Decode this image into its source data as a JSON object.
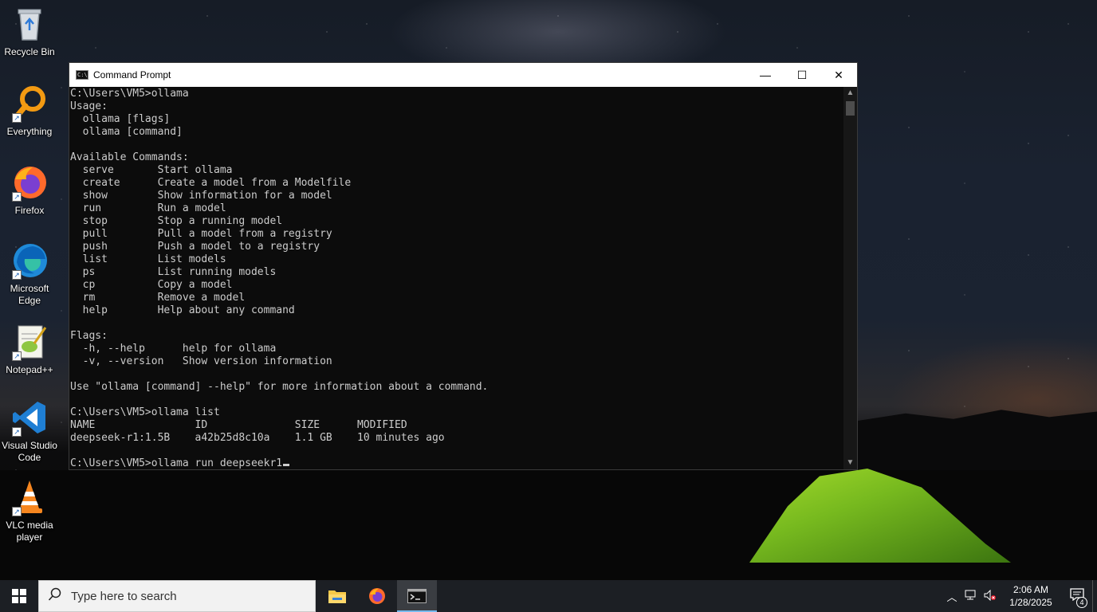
{
  "desktop": {
    "icons": [
      {
        "label": "Recycle Bin",
        "icon": "recycle-bin-icon"
      },
      {
        "label": "Everything",
        "icon": "everything-search-icon"
      },
      {
        "label": "Firefox",
        "icon": "firefox-icon"
      },
      {
        "label": "Microsoft Edge",
        "icon": "edge-icon"
      },
      {
        "label": "Notepad++",
        "icon": "notepadpp-icon"
      },
      {
        "label": "Visual Studio Code",
        "icon": "vscode-icon"
      },
      {
        "label": "VLC media player",
        "icon": "vlc-icon"
      }
    ]
  },
  "window": {
    "title": "Command Prompt",
    "minimize": "—",
    "maximize": "☐",
    "close": "✕"
  },
  "console": {
    "lines": [
      "C:\\Users\\VM5>ollama",
      "Usage:",
      "  ollama [flags]",
      "  ollama [command]",
      "",
      "Available Commands:",
      "  serve       Start ollama",
      "  create      Create a model from a Modelfile",
      "  show        Show information for a model",
      "  run         Run a model",
      "  stop        Stop a running model",
      "  pull        Pull a model from a registry",
      "  push        Push a model to a registry",
      "  list        List models",
      "  ps          List running models",
      "  cp          Copy a model",
      "  rm          Remove a model",
      "  help        Help about any command",
      "",
      "Flags:",
      "  -h, --help      help for ollama",
      "  -v, --version   Show version information",
      "",
      "Use \"ollama [command] --help\" for more information about a command.",
      "",
      "C:\\Users\\VM5>ollama list",
      "NAME                ID              SIZE      MODIFIED",
      "deepseek-r1:1.5B    a42b25d8c10a    1.1 GB    10 minutes ago",
      ""
    ],
    "prompt_line": "C:\\Users\\VM5>ollama run deepseekr1"
  },
  "taskbar": {
    "search_placeholder": "Type here to search",
    "apps": [
      {
        "name": "file-explorer-icon",
        "label": "File Explorer"
      },
      {
        "name": "firefox-icon",
        "label": "Firefox"
      },
      {
        "name": "command-prompt-icon",
        "label": "Command Prompt"
      }
    ],
    "time": "2:06 AM",
    "date": "1/28/2025",
    "notification_count": "4"
  },
  "colors": {
    "console_bg": "#0c0c0c",
    "console_fg": "#cccccc",
    "taskbar_bg": "#1c1f24",
    "accent": "#76b9ed"
  }
}
